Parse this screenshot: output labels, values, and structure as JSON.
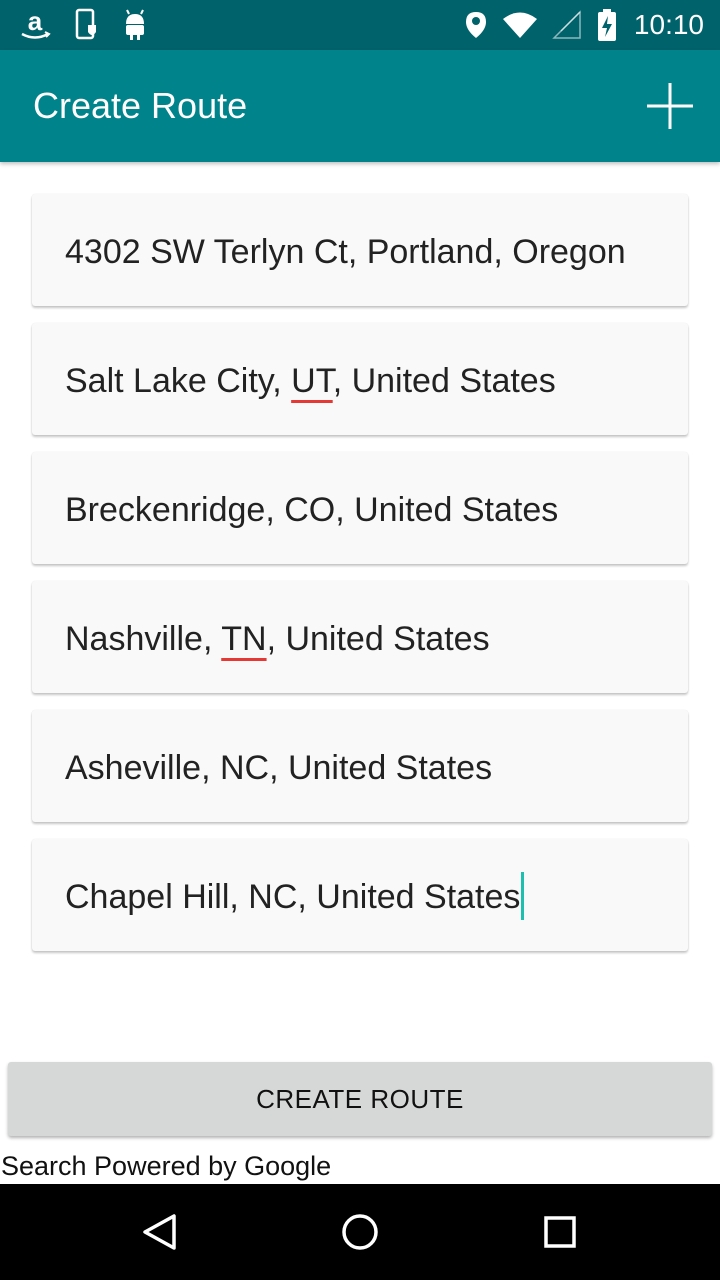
{
  "status_bar": {
    "time": "10:10",
    "left_icons": [
      "amazon-icon",
      "phone-shield-icon",
      "android-icon"
    ],
    "right_icons": [
      "location-icon",
      "wifi-icon",
      "signal-icon",
      "battery-charging-icon"
    ]
  },
  "app_bar": {
    "title": "Create Route",
    "add_icon": "plus-icon",
    "color": "#00838a",
    "status_color": "#00626b"
  },
  "route": {
    "stops": [
      {
        "pre": "4302 SW Terlyn Ct, Portland, Oregon",
        "flag": "",
        "post": ""
      },
      {
        "pre": "Salt Lake City, ",
        "flag": "UT",
        "post": ", United States"
      },
      {
        "pre": "Breckenridge, CO, United States",
        "flag": "",
        "post": ""
      },
      {
        "pre": "Nashville, ",
        "flag": "TN",
        "post": ", United States"
      },
      {
        "pre": "Asheville, NC, United States",
        "flag": "",
        "post": ""
      },
      {
        "pre": "Chapel Hill, NC, United States",
        "flag": "",
        "post": ""
      }
    ],
    "focused_index": 5
  },
  "actions": {
    "create_label": "CREATE ROUTE",
    "powered_by": "Search Powered by Google"
  },
  "nav_bar": {
    "icons": [
      "back-icon",
      "home-icon",
      "recents-icon"
    ]
  }
}
